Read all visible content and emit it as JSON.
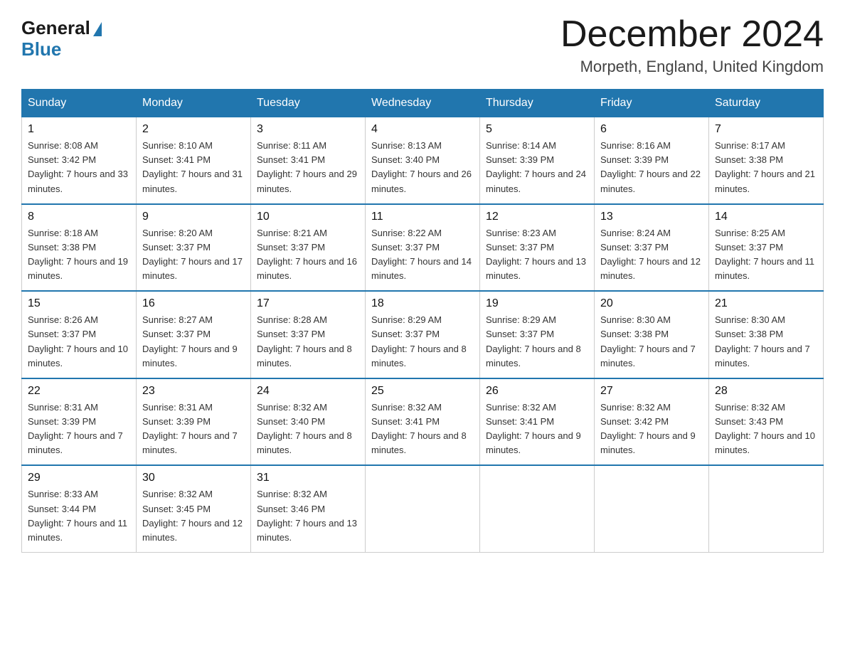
{
  "header": {
    "logo_general": "General",
    "logo_blue": "Blue",
    "month_title": "December 2024",
    "location": "Morpeth, England, United Kingdom"
  },
  "weekdays": [
    "Sunday",
    "Monday",
    "Tuesday",
    "Wednesday",
    "Thursday",
    "Friday",
    "Saturday"
  ],
  "weeks": [
    [
      {
        "day": "1",
        "sunrise": "8:08 AM",
        "sunset": "3:42 PM",
        "daylight": "7 hours and 33 minutes."
      },
      {
        "day": "2",
        "sunrise": "8:10 AM",
        "sunset": "3:41 PM",
        "daylight": "7 hours and 31 minutes."
      },
      {
        "day": "3",
        "sunrise": "8:11 AM",
        "sunset": "3:41 PM",
        "daylight": "7 hours and 29 minutes."
      },
      {
        "day": "4",
        "sunrise": "8:13 AM",
        "sunset": "3:40 PM",
        "daylight": "7 hours and 26 minutes."
      },
      {
        "day": "5",
        "sunrise": "8:14 AM",
        "sunset": "3:39 PM",
        "daylight": "7 hours and 24 minutes."
      },
      {
        "day": "6",
        "sunrise": "8:16 AM",
        "sunset": "3:39 PM",
        "daylight": "7 hours and 22 minutes."
      },
      {
        "day": "7",
        "sunrise": "8:17 AM",
        "sunset": "3:38 PM",
        "daylight": "7 hours and 21 minutes."
      }
    ],
    [
      {
        "day": "8",
        "sunrise": "8:18 AM",
        "sunset": "3:38 PM",
        "daylight": "7 hours and 19 minutes."
      },
      {
        "day": "9",
        "sunrise": "8:20 AM",
        "sunset": "3:37 PM",
        "daylight": "7 hours and 17 minutes."
      },
      {
        "day": "10",
        "sunrise": "8:21 AM",
        "sunset": "3:37 PM",
        "daylight": "7 hours and 16 minutes."
      },
      {
        "day": "11",
        "sunrise": "8:22 AM",
        "sunset": "3:37 PM",
        "daylight": "7 hours and 14 minutes."
      },
      {
        "day": "12",
        "sunrise": "8:23 AM",
        "sunset": "3:37 PM",
        "daylight": "7 hours and 13 minutes."
      },
      {
        "day": "13",
        "sunrise": "8:24 AM",
        "sunset": "3:37 PM",
        "daylight": "7 hours and 12 minutes."
      },
      {
        "day": "14",
        "sunrise": "8:25 AM",
        "sunset": "3:37 PM",
        "daylight": "7 hours and 11 minutes."
      }
    ],
    [
      {
        "day": "15",
        "sunrise": "8:26 AM",
        "sunset": "3:37 PM",
        "daylight": "7 hours and 10 minutes."
      },
      {
        "day": "16",
        "sunrise": "8:27 AM",
        "sunset": "3:37 PM",
        "daylight": "7 hours and 9 minutes."
      },
      {
        "day": "17",
        "sunrise": "8:28 AM",
        "sunset": "3:37 PM",
        "daylight": "7 hours and 8 minutes."
      },
      {
        "day": "18",
        "sunrise": "8:29 AM",
        "sunset": "3:37 PM",
        "daylight": "7 hours and 8 minutes."
      },
      {
        "day": "19",
        "sunrise": "8:29 AM",
        "sunset": "3:37 PM",
        "daylight": "7 hours and 8 minutes."
      },
      {
        "day": "20",
        "sunrise": "8:30 AM",
        "sunset": "3:38 PM",
        "daylight": "7 hours and 7 minutes."
      },
      {
        "day": "21",
        "sunrise": "8:30 AM",
        "sunset": "3:38 PM",
        "daylight": "7 hours and 7 minutes."
      }
    ],
    [
      {
        "day": "22",
        "sunrise": "8:31 AM",
        "sunset": "3:39 PM",
        "daylight": "7 hours and 7 minutes."
      },
      {
        "day": "23",
        "sunrise": "8:31 AM",
        "sunset": "3:39 PM",
        "daylight": "7 hours and 7 minutes."
      },
      {
        "day": "24",
        "sunrise": "8:32 AM",
        "sunset": "3:40 PM",
        "daylight": "7 hours and 8 minutes."
      },
      {
        "day": "25",
        "sunrise": "8:32 AM",
        "sunset": "3:41 PM",
        "daylight": "7 hours and 8 minutes."
      },
      {
        "day": "26",
        "sunrise": "8:32 AM",
        "sunset": "3:41 PM",
        "daylight": "7 hours and 9 minutes."
      },
      {
        "day": "27",
        "sunrise": "8:32 AM",
        "sunset": "3:42 PM",
        "daylight": "7 hours and 9 minutes."
      },
      {
        "day": "28",
        "sunrise": "8:32 AM",
        "sunset": "3:43 PM",
        "daylight": "7 hours and 10 minutes."
      }
    ],
    [
      {
        "day": "29",
        "sunrise": "8:33 AM",
        "sunset": "3:44 PM",
        "daylight": "7 hours and 11 minutes."
      },
      {
        "day": "30",
        "sunrise": "8:32 AM",
        "sunset": "3:45 PM",
        "daylight": "7 hours and 12 minutes."
      },
      {
        "day": "31",
        "sunrise": "8:32 AM",
        "sunset": "3:46 PM",
        "daylight": "7 hours and 13 minutes."
      },
      null,
      null,
      null,
      null
    ]
  ]
}
